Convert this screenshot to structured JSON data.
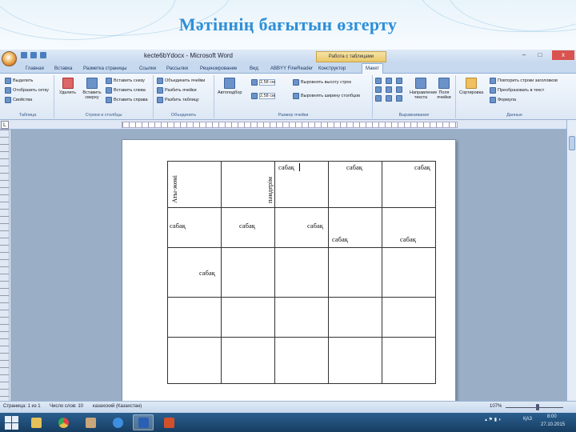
{
  "slide": {
    "title": "Мәтіннің бағытын өзгерту"
  },
  "word": {
    "doc_title": "kecte6bYdocx - Microsoft Word",
    "table_tools": "Работа с таблицами",
    "window": {
      "min": "–",
      "max": "□",
      "close": "x"
    },
    "tabs": [
      "Главная",
      "Вставка",
      "Разметка страницы",
      "Ссылки",
      "Рассылки",
      "Рецензирование",
      "Вид",
      "ABBYY FineReader",
      "Конструктор",
      "Макет"
    ],
    "ribbon": {
      "groups": {
        "table": {
          "label": "Таблица",
          "items": [
            "Выделить",
            "Отобразить сетку",
            "Свойства"
          ]
        },
        "rows_cols": {
          "label": "Строки и столбцы",
          "delete": "Удалить",
          "insert_above": "Вставить сверху",
          "items": [
            "Вставить снизу",
            "Вставить слева",
            "Вставить справа"
          ]
        },
        "merge": {
          "label": "Объединить",
          "items": [
            "Объединить ячейки",
            "Разбить ячейки",
            "Разбить таблицу"
          ]
        },
        "cell_size": {
          "label": "Размер ячейки",
          "autofit": "Автоподбор",
          "height": "2,58 см",
          "width": "2,58 см",
          "dist_rows": "Выровнять высоту строк",
          "dist_cols": "Выровнять ширину столбцов"
        },
        "alignment": {
          "label": "Выравнивание",
          "direction": "Направление текста",
          "margins": "Поля ячейки"
        },
        "data": {
          "label": "Данные",
          "sort": "Сортировка",
          "items": [
            "Повторить строки заголовков",
            "Преобразовать в текст",
            "Формула"
          ]
        }
      }
    },
    "ruler_tab_stop": "L",
    "status": {
      "page": "Страница: 1 из 1",
      "words": "Число слов: 10",
      "language": "казахский (Казахстан)",
      "zoom": "107%",
      "zoom_fraction": 0.56
    },
    "table": {
      "rows": [
        [
          "Аты-жөні",
          "пәндерім",
          "сабақ",
          "сабақ",
          "сабақ"
        ],
        [
          "сабақ",
          "сабақ",
          "сабақ",
          "сабақ",
          "сабақ"
        ],
        [
          "",
          "сабақ",
          "",
          "",
          ""
        ],
        [
          "",
          "",
          "",
          "",
          ""
        ],
        [
          "",
          "",
          "",
          "",
          ""
        ]
      ]
    }
  },
  "taskbar": {
    "apps": [
      "explorer",
      "chrome",
      "media",
      "internet-explorer",
      "word",
      "powerpoint"
    ],
    "tray": {
      "lang": "ҚАЗ",
      "time": "8:00",
      "date": "27.10.2015"
    }
  }
}
